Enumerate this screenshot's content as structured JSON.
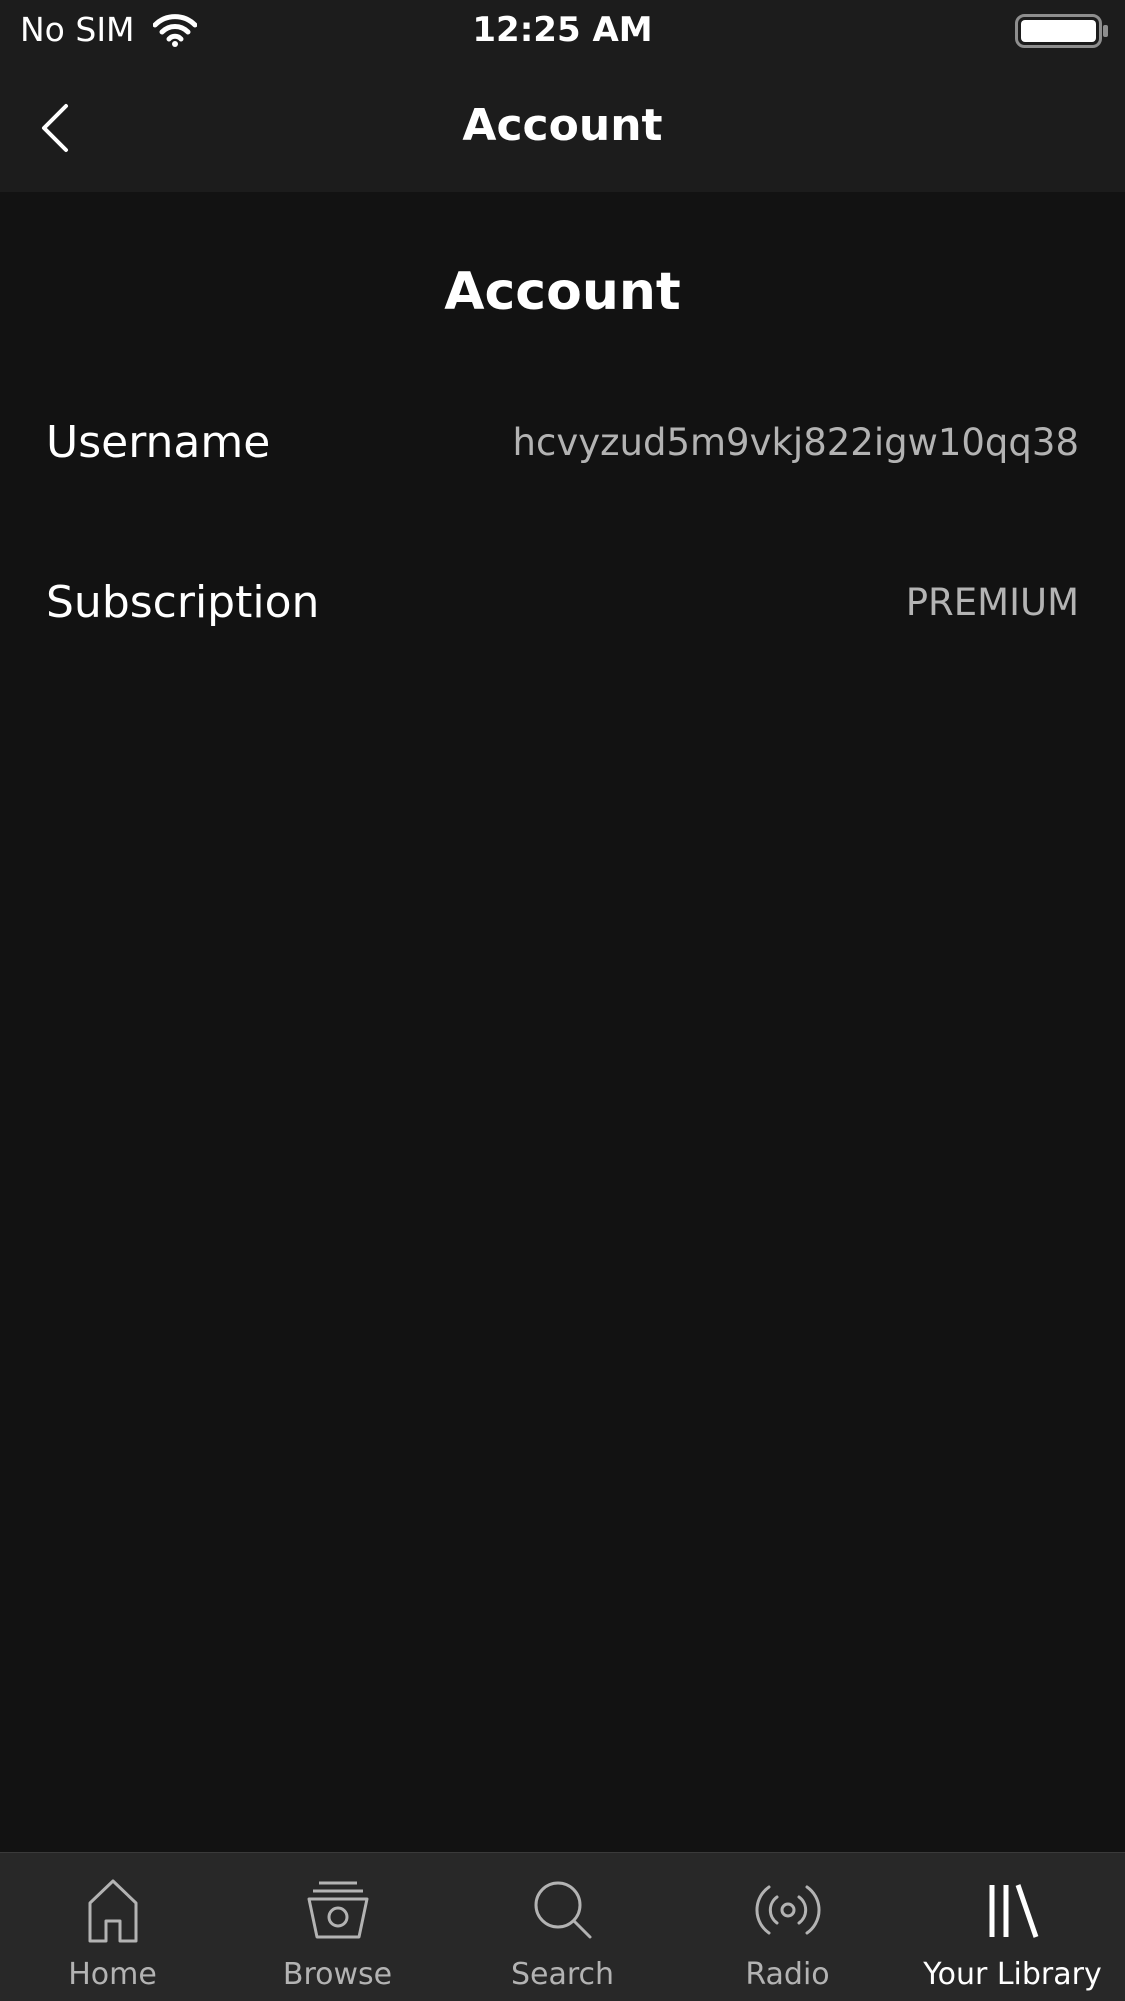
{
  "status_bar": {
    "carrier": "No SIM",
    "time": "12:25 AM"
  },
  "nav": {
    "title": "Account",
    "back_icon": "chevron-left-icon"
  },
  "account": {
    "heading": "Account",
    "rows": [
      {
        "label": "Username",
        "value": "hcvyzud5m9vkj822igw10qq38"
      },
      {
        "label": "Subscription",
        "value": "PREMIUM"
      }
    ]
  },
  "tabs": [
    {
      "label": "Home",
      "icon": "home-icon"
    },
    {
      "label": "Browse",
      "icon": "browse-icon"
    },
    {
      "label": "Search",
      "icon": "search-icon"
    },
    {
      "label": "Radio",
      "icon": "radio-icon"
    },
    {
      "label": "Your Library",
      "icon": "library-icon",
      "active": true
    }
  ],
  "colors": {
    "background": "#121212",
    "bar_background": "#1c1c1c",
    "tab_bar_background": "#282828",
    "text_primary": "#ffffff",
    "text_secondary": "#b3b3b3"
  }
}
